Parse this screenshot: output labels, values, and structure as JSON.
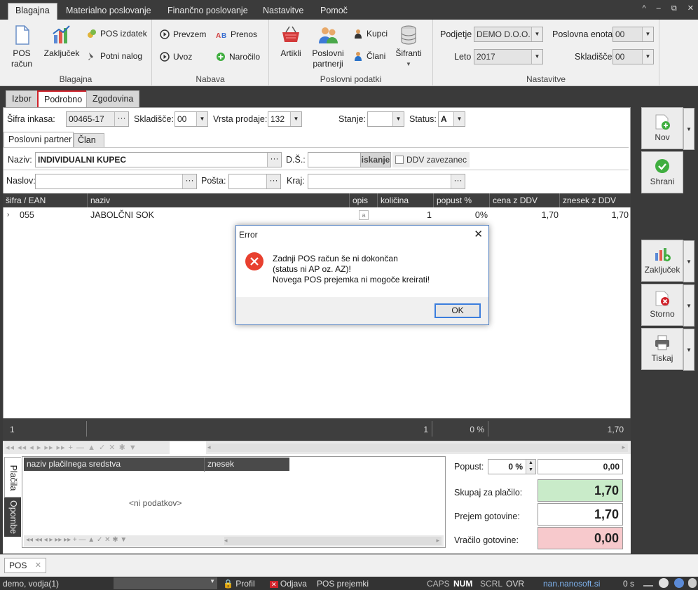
{
  "menubar": {
    "tabs": [
      "Blagajna",
      "Materialno poslovanje",
      "Finančno poslovanje",
      "Nastavitve",
      "Pomoč"
    ],
    "window_controls": [
      "^",
      "–",
      "⧉",
      "✕"
    ]
  },
  "ribbon": {
    "blagajna": {
      "pos_racun": "POS\nračun",
      "pos_racun_l1": "POS",
      "pos_racun_l2": "račun",
      "zakljucek": "Zaključek",
      "pos_izdatek": "POS izdatek",
      "potni_nalog": "Potni nalog",
      "group_label": "Blagajna"
    },
    "nabava": {
      "prevzem": "Prevzem",
      "prenos": "Prenos",
      "uvoz": "Uvoz",
      "narocilo": "Naročilo",
      "group_label": "Nabava"
    },
    "poslovni_podatki": {
      "artikli": "Artikli",
      "poslovni_partnerji_l1": "Poslovni",
      "poslovni_partnerji_l2": "partnerji",
      "kupci": "Kupci",
      "clani": "Člani",
      "sifranti": "Šifranti",
      "group_label": "Poslovni podatki"
    },
    "nastavitve": {
      "podjetje_label": "Podjetje",
      "podjetje_value": "DEMO D.O.O.",
      "leto_label": "Leto",
      "leto_value": "2017",
      "poslovna_enota_label": "Poslovna enota",
      "poslovna_enota_value": "00",
      "skladisce_label": "Skladišče",
      "skladisce_value": "00",
      "group_label": "Nastavitve"
    }
  },
  "view_tabs": [
    "Izbor",
    "Podrobno",
    "Zgodovina"
  ],
  "header_fields": {
    "sifra_inkasa_label": "Šifra inkasa:",
    "sifra_inkasa_value": "00465-17",
    "skladisce_label": "Skladišče:",
    "skladisce_value": "00",
    "vrsta_prodaje_label": "Vrsta prodaje:",
    "vrsta_prodaje_value": "132",
    "stanje_label": "Stanje:",
    "stanje_value": "",
    "status_label": "Status:",
    "status_value": "A"
  },
  "partner_tabs": [
    "Poslovni partner",
    "Član"
  ],
  "partner": {
    "naziv_label": "Naziv:",
    "naziv_value": "INDIVIDUALNI KUPEC",
    "ds_label": "D.Š.:",
    "ds_value": "",
    "iskanje_label": "iskanje",
    "ddv_label": "DDV zavezanec",
    "naslov_label": "Naslov:",
    "posta_label": "Pošta:",
    "kraj_label": "Kraj:"
  },
  "grid": {
    "columns": [
      "šifra / EAN",
      "naziv",
      "opis",
      "količina",
      "popust %",
      "cena z DDV",
      "znesek z DDV"
    ],
    "rows": [
      {
        "sifra": "055",
        "naziv": "JABOLČNI SOK",
        "opis": "a",
        "kolicina": "1",
        "popust": "0%",
        "cena": "1,70",
        "znesek": "1,70"
      }
    ],
    "summary": {
      "count": "1",
      "kolicina": "1",
      "popust": "0 %",
      "znesek": "1,70"
    },
    "nav_glyphs": "◂◂ ◂◂ ◂ ▸ ▸▸ ▸▸ + — ▲ ✓ ✕ ✱ ▼"
  },
  "dialog": {
    "title": "Error",
    "line1": "Zadnji POS račun še ni dokončan",
    "line2": "(status ni AP oz. AZ)!",
    "line3": "Novega POS prejemka ni mogoče kreirati!",
    "ok_label": "OK"
  },
  "right_buttons": {
    "nov": "Nov",
    "shrani": "Shrani",
    "zakljucek": "Zaključek",
    "storno": "Storno",
    "tiskaj": "Tiskaj"
  },
  "payments": {
    "side_tabs": [
      "Plačila",
      "Opombe"
    ],
    "columns": [
      "naziv plačilnega sredstva",
      "znesek"
    ],
    "empty": "<ni podatkov>"
  },
  "totals": {
    "popust_label": "Popust:",
    "popust_pct": "0 %",
    "popust_value": "0,00",
    "skupaj_label": "Skupaj za plačilo:",
    "skupaj_value": "1,70",
    "prejem_label": "Prejem gotovine:",
    "prejem_value": "1,70",
    "vracilo_label": "Vračilo gotovine:",
    "vracilo_value": "0,00"
  },
  "doc_tabs": [
    {
      "label": "POS",
      "close": "✕"
    }
  ],
  "statusbar": {
    "user": "demo, vodja(1)",
    "profil": "Profil",
    "odjava": "Odjava",
    "module": "POS prejemki",
    "caps": "CAPS",
    "num": "NUM",
    "scrl": "SCRL",
    "ovr": "OVR",
    "server": "nan.nanosoft.si",
    "time": "0 s"
  },
  "colors": {
    "dark_bar": "#3e3e3e",
    "accent_red": "#d0222a",
    "skupaj_bg": "#c9ebc9",
    "vracilo_bg": "#f7c9cc",
    "link_blue": "#7fb4f0"
  }
}
